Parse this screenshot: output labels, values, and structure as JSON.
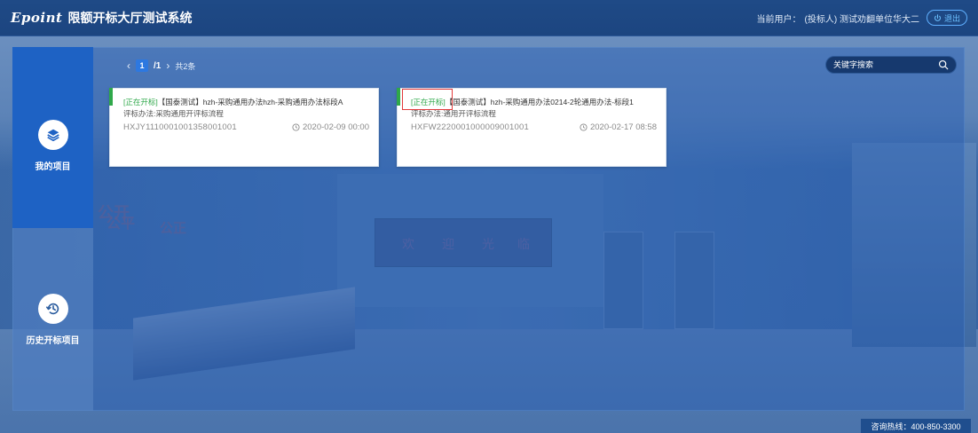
{
  "header": {
    "logo_text": "Epoint",
    "title": "限额开标大厅测试系统",
    "current_user_label": "当前用户：",
    "current_user_name": "(投标人) 测试劝翻单位华大二",
    "logout_label": "退出"
  },
  "background_text": {
    "wall_left_1": "公开",
    "wall_left_2": "公平",
    "wall_left_3": "公正",
    "board_chars": [
      "欢",
      "迎",
      "光",
      "临"
    ]
  },
  "sidebar": {
    "items": [
      {
        "label": "我的项目",
        "icon": "layers-icon",
        "active": true
      },
      {
        "label": "历史开标项目",
        "icon": "history-icon",
        "active": false
      }
    ]
  },
  "pager": {
    "prev": "‹",
    "current": "1",
    "total": "/1",
    "next": "›",
    "count": "共2条"
  },
  "search": {
    "placeholder": "关键字搜索"
  },
  "projects": [
    {
      "status": "[正在开标]",
      "title": "【国泰测试】hzh-采购通用办法hzh-采购通用办法标段A",
      "flow": "评标办法:采购通用开评标流程",
      "code": "HXJY1110001001358001001",
      "time": "2020-02-09 00:00",
      "highlighted": false
    },
    {
      "status": "[正在开标]",
      "title": "【国泰测试】hzh-采购通用办法0214-2轮通用办法-标段1",
      "flow": "评标办法:通用开评标流程",
      "code": "HXFW2220001000009001001",
      "time": "2020-02-17 08:58",
      "highlighted": true
    }
  ],
  "footer": {
    "hotline": "咨询热线：400-850-3300"
  },
  "colors": {
    "topbar": "#1f4a86",
    "sidebar_active": "#1e62c4",
    "status_green": "#2fa84a",
    "highlight_red": "#e23a3a",
    "pager_current": "#2d78e0"
  }
}
